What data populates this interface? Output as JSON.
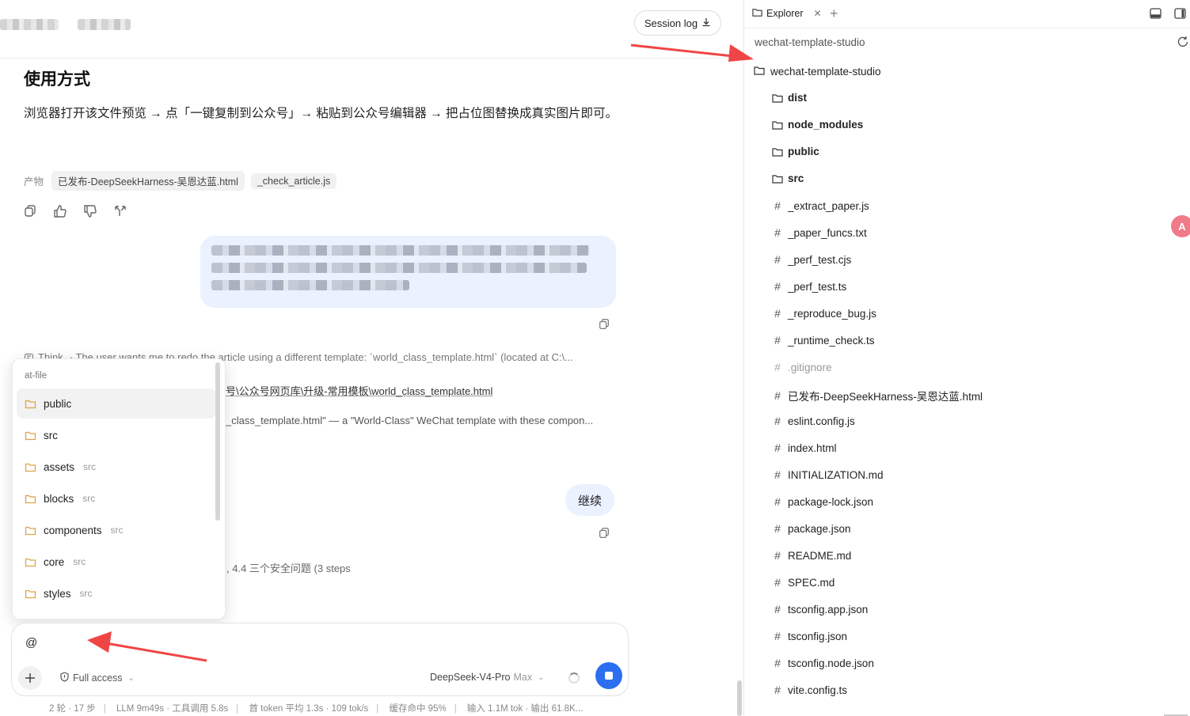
{
  "chat": {
    "session_log_label": "Session log",
    "section_heading": "使用方式",
    "section_text": "浏览器打开该文件预览 → 点「一键复制到公众号」→ 粘贴到公众号编辑器 → 把占位图替换成真实图片即可。",
    "artifacts_label": "产物",
    "artifacts": [
      "已发布-DeepSeekHarness-吴恩达蓝.html",
      "_check_article.js"
    ],
    "think_label": "Think",
    "think_text": "· The user wants me to redo the article using a different template: `world_class_template.html` (located at C:\\...",
    "path_fragment": "号\\公众号网页库\\升级-常用模板\\world_class_template.html",
    "template_fragment": "_class_template.html\" — a \"World-Class\" WeChat template with these compon...",
    "continue_text": "继续",
    "steps_fragment": ", 4.4 三个安全问题 (3 steps"
  },
  "popup": {
    "title": "at-file",
    "items": [
      {
        "name": "public",
        "sub": ""
      },
      {
        "name": "src",
        "sub": ""
      },
      {
        "name": "assets",
        "sub": "src"
      },
      {
        "name": "blocks",
        "sub": "src"
      },
      {
        "name": "components",
        "sub": "src"
      },
      {
        "name": "core",
        "sub": "src"
      },
      {
        "name": "styles",
        "sub": "src"
      }
    ]
  },
  "composer": {
    "input_value": "@",
    "access_label": "Full access",
    "model_name": "DeepSeek-V4-Pro",
    "model_tier": "Max"
  },
  "status_bar": {
    "rounds": "2 轮 · 17 步",
    "llm": "LLM 9m49s · 工具调用 5.8s",
    "token": "首 token 平均 1.3s · 109 tok/s",
    "cache": "缓存命中 95%",
    "io": "输入 1.1M tok · 输出 61.8K..."
  },
  "explorer": {
    "tab_label": "Explorer",
    "path": "wechat-template-studio",
    "root": "wechat-template-studio",
    "folders": [
      "dist",
      "node_modules",
      "public",
      "src"
    ],
    "files": [
      {
        "name": "_extract_paper.js",
        "muted": false
      },
      {
        "name": "_paper_funcs.txt",
        "muted": false
      },
      {
        "name": "_perf_test.cjs",
        "muted": false
      },
      {
        "name": "_perf_test.ts",
        "muted": false
      },
      {
        "name": "_reproduce_bug.js",
        "muted": false
      },
      {
        "name": "_runtime_check.ts",
        "muted": false
      },
      {
        "name": ".gitignore",
        "muted": true
      },
      {
        "name": "已发布-DeepSeekHarness-吴恩达蓝.html",
        "muted": false
      },
      {
        "name": "eslint.config.js",
        "muted": false
      },
      {
        "name": "index.html",
        "muted": false
      },
      {
        "name": "INITIALIZATION.md",
        "muted": false
      },
      {
        "name": "package-lock.json",
        "muted": false
      },
      {
        "name": "package.json",
        "muted": false
      },
      {
        "name": "README.md",
        "muted": false
      },
      {
        "name": "SPEC.md",
        "muted": false
      },
      {
        "name": "tsconfig.app.json",
        "muted": false
      },
      {
        "name": "tsconfig.json",
        "muted": false
      },
      {
        "name": "tsconfig.node.json",
        "muted": false
      },
      {
        "name": "vite.config.ts",
        "muted": false
      }
    ]
  },
  "colors": {
    "accent": "#2b6ef0",
    "bubble": "#eaf1ff",
    "annotation_arrow": "#f04545"
  }
}
